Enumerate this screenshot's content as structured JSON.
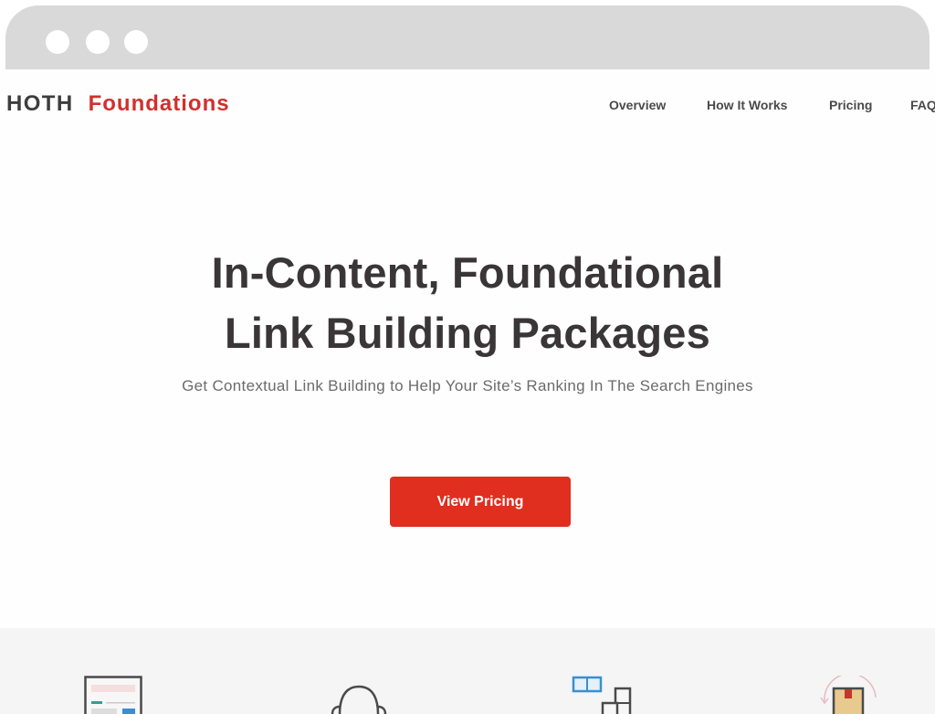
{
  "browser": {
    "window_dots": [
      "close",
      "minimize",
      "maximize"
    ]
  },
  "navbar": {
    "logo_primary": "HOTH",
    "logo_secondary": "Foundations",
    "links": [
      {
        "label": "Overview"
      },
      {
        "label": "How It Works"
      },
      {
        "label": "Pricing"
      },
      {
        "label": "FAQ"
      }
    ]
  },
  "hero": {
    "title_line1": "In-Content, Foundational",
    "title_line2": "Link Building Packages",
    "subtitle": "Get Contextual Link Building to Help Your Site’s Ranking In The Search Engines",
    "cta_label": "View Pricing"
  },
  "features": {
    "icons": [
      "document-form-icon",
      "person-headset-icon",
      "blocks-layout-icon",
      "package-return-icon"
    ]
  },
  "colors": {
    "brand_red": "#d0312d",
    "cta_red": "#e02e1f",
    "text_dark": "#3a3536",
    "chrome_gray": "#d9d9d9",
    "section_gray": "#f5f5f6",
    "accent_blue": "#3a8fd0"
  }
}
